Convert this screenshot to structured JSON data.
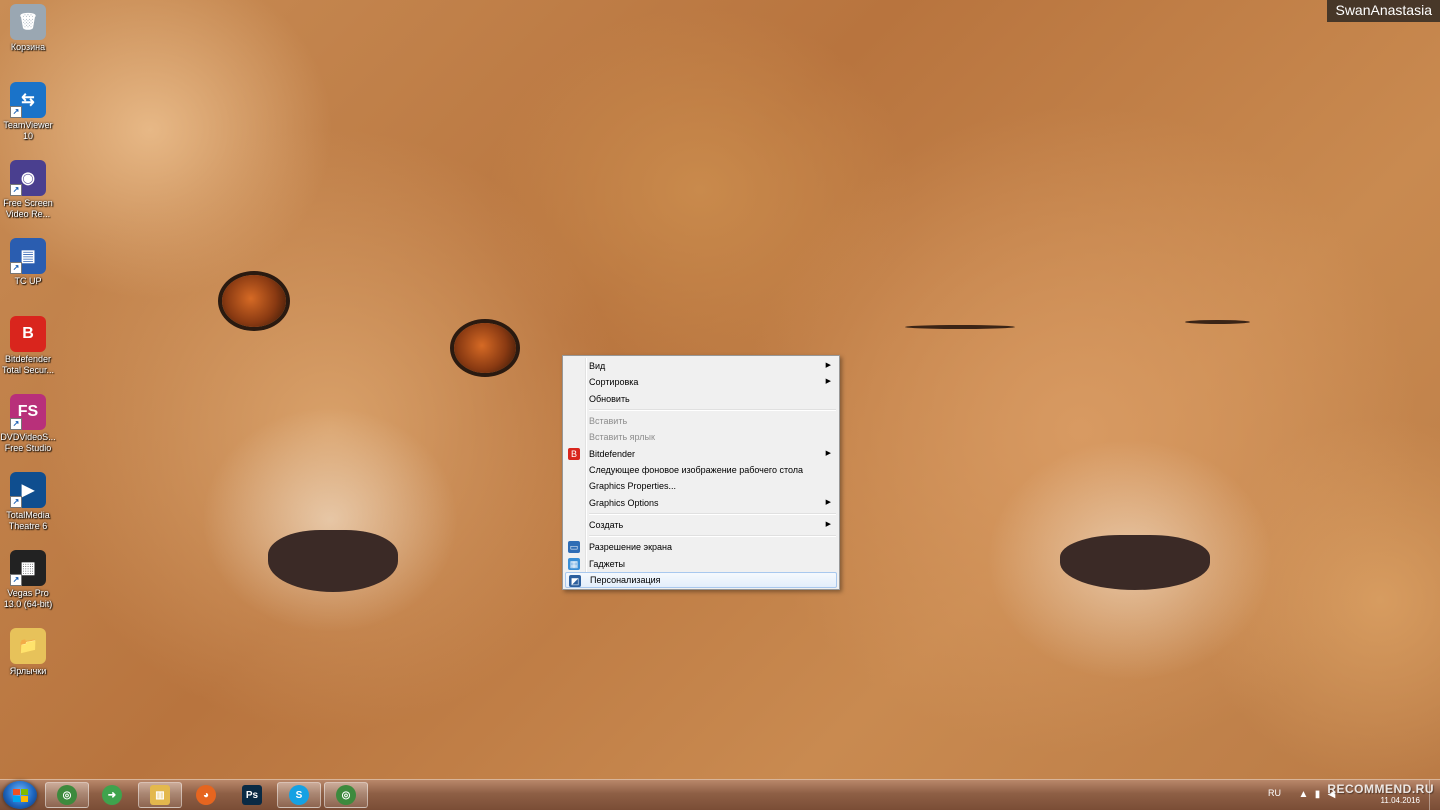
{
  "top_label": "SwanAnastasia",
  "desktop_icons": [
    {
      "label": "Корзина",
      "icon": "recycle-bin-icon",
      "color": "#9aa7b2",
      "glyph": "🗑",
      "shortcut": false
    },
    {
      "label": "TeamViewer 10",
      "icon": "teamviewer-icon",
      "color": "#1a73c9",
      "glyph": "⇆",
      "shortcut": true
    },
    {
      "label": "Free Screen Video Re...",
      "icon": "screen-recorder-icon",
      "color": "#4a3f8f",
      "glyph": "◉",
      "shortcut": true
    },
    {
      "label": "TC UP",
      "icon": "total-commander-icon",
      "color": "#2a5db0",
      "glyph": "▤",
      "shortcut": true
    },
    {
      "label": "Bitdefender Total Secur...",
      "icon": "bitdefender-icon",
      "color": "#d9251d",
      "glyph": "B",
      "shortcut": false
    },
    {
      "label": "DVDVideoS... Free Studio",
      "icon": "dvdvideosoft-icon",
      "color": "#b8307a",
      "glyph": "FS",
      "shortcut": true
    },
    {
      "label": "TotalMedia Theatre 6",
      "icon": "totalmedia-icon",
      "color": "#0f4e8f",
      "glyph": "▶",
      "shortcut": true
    },
    {
      "label": "Vegas Pro 13.0 (64-bit)",
      "icon": "vegas-pro-icon",
      "color": "#222222",
      "glyph": "▦",
      "shortcut": true
    },
    {
      "label": "Ярлычки",
      "icon": "folder-icon",
      "color": "#e7c25a",
      "glyph": "📁",
      "shortcut": false
    }
  ],
  "context_menu": {
    "items": [
      {
        "label": "Вид",
        "submenu": true,
        "disabled": false
      },
      {
        "label": "Сортировка",
        "submenu": true,
        "disabled": false
      },
      {
        "label": "Обновить",
        "submenu": false,
        "disabled": false
      },
      {
        "label": "Вставить",
        "submenu": false,
        "disabled": true
      },
      {
        "label": "Вставить ярлык",
        "submenu": false,
        "disabled": true
      },
      {
        "label": "Bitdefender",
        "submenu": true,
        "disabled": false,
        "icon": "bitdefender-icon"
      },
      {
        "label": "Следующее фоновое изображение рабочего стола",
        "submenu": false,
        "disabled": false
      },
      {
        "label": "Graphics Properties...",
        "submenu": false,
        "disabled": false
      },
      {
        "label": "Graphics Options",
        "submenu": true,
        "disabled": false
      },
      {
        "label": "Создать",
        "submenu": true,
        "disabled": false
      },
      {
        "label": "Разрешение экрана",
        "submenu": false,
        "disabled": false,
        "icon": "screen-resolution-icon"
      },
      {
        "label": "Гаджеты",
        "submenu": false,
        "disabled": false,
        "icon": "gadgets-icon"
      },
      {
        "label": "Персонализация",
        "submenu": false,
        "disabled": false,
        "icon": "personalization-icon",
        "hover": true
      }
    ]
  },
  "taskbar": {
    "apps": [
      {
        "name": "chrome",
        "color": "#3d8a3d",
        "glyph": "◎",
        "active": true
      },
      {
        "name": "download",
        "color": "#3fa34d",
        "glyph": "➜",
        "active": false
      },
      {
        "name": "explorer",
        "color": "#e3b84d",
        "glyph": "▥",
        "active": true
      },
      {
        "name": "firefox",
        "color": "#e6651f",
        "glyph": "◕",
        "active": false
      },
      {
        "name": "photoshop",
        "color": "#0a2a44",
        "glyph": "Ps",
        "active": false
      },
      {
        "name": "skype",
        "color": "#15a1e3",
        "glyph": "S",
        "active": true
      },
      {
        "name": "chrome",
        "color": "#3d8a3d",
        "glyph": "◎",
        "active": true
      }
    ],
    "language": "RU",
    "watermark": "RECOMMEND.RU",
    "date": "11.04.2016"
  }
}
